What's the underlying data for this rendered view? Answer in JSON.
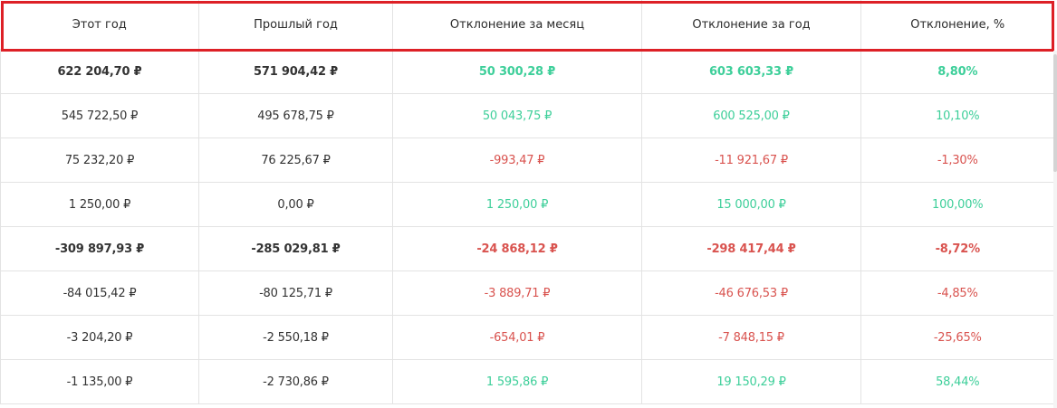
{
  "header": {
    "columns": [
      "Этот год",
      "Прошлый год",
      "Отклонение за месяц",
      "Отклонение за год",
      "Отклонение, %"
    ]
  },
  "rows": [
    {
      "bold": true,
      "cells": [
        "622 204,70 ₽",
        "571 904,42 ₽",
        "50 300,28 ₽",
        "603 603,33 ₽",
        "8,80%"
      ],
      "signs": [
        "",
        "",
        "pos",
        "pos",
        "pos"
      ]
    },
    {
      "bold": false,
      "cells": [
        "545 722,50 ₽",
        "495 678,75 ₽",
        "50 043,75 ₽",
        "600 525,00 ₽",
        "10,10%"
      ],
      "signs": [
        "",
        "",
        "pos",
        "pos",
        "pos"
      ]
    },
    {
      "bold": false,
      "cells": [
        "75 232,20 ₽",
        "76 225,67 ₽",
        "-993,47 ₽",
        "-11 921,67 ₽",
        "-1,30%"
      ],
      "signs": [
        "",
        "",
        "neg",
        "neg",
        "neg"
      ]
    },
    {
      "bold": false,
      "cells": [
        "1 250,00 ₽",
        "0,00 ₽",
        "1 250,00 ₽",
        "15 000,00 ₽",
        "100,00%"
      ],
      "signs": [
        "",
        "",
        "pos",
        "pos",
        "pos"
      ]
    },
    {
      "bold": true,
      "cells": [
        "-309 897,93 ₽",
        "-285 029,81 ₽",
        "-24 868,12 ₽",
        "-298 417,44 ₽",
        "-8,72%"
      ],
      "signs": [
        "",
        "",
        "neg",
        "neg",
        "neg"
      ]
    },
    {
      "bold": false,
      "cells": [
        "-84 015,42 ₽",
        "-80 125,71 ₽",
        "-3 889,71 ₽",
        "-46 676,53 ₽",
        "-4,85%"
      ],
      "signs": [
        "",
        "",
        "neg",
        "neg",
        "neg"
      ]
    },
    {
      "bold": false,
      "cells": [
        "-3 204,20 ₽",
        "-2 550,18 ₽",
        "-654,01 ₽",
        "-7 848,15 ₽",
        "-25,65%"
      ],
      "signs": [
        "",
        "",
        "neg",
        "neg",
        "neg"
      ]
    },
    {
      "bold": false,
      "cells": [
        "-1 135,00 ₽",
        "-2 730,86 ₽",
        "1 595,86 ₽",
        "19 150,29 ₽",
        "58,44%"
      ],
      "signs": [
        "",
        "",
        "pos",
        "pos",
        "pos"
      ]
    }
  ],
  "colors": {
    "positive": "#3ecf9a",
    "negative": "#d9534f",
    "highlight": "#dd2026"
  }
}
